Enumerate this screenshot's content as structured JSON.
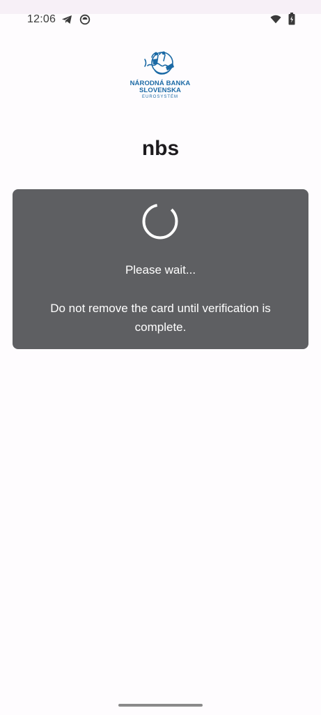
{
  "status_bar": {
    "time": "12:06",
    "icons": [
      "telegram-icon",
      "app-status-icon",
      "wifi-icon",
      "battery-icon"
    ]
  },
  "logo": {
    "line1": "NÁRODNÁ BANKA",
    "line2": "SLOVENSKA",
    "line3": "EUROSYSTÉM",
    "color": "#1c6aa5"
  },
  "page": {
    "title": "nbs"
  },
  "dialog": {
    "status": "Please wait...",
    "message": "Do not remove the card until verification is complete.",
    "background": "#5e5f62"
  }
}
